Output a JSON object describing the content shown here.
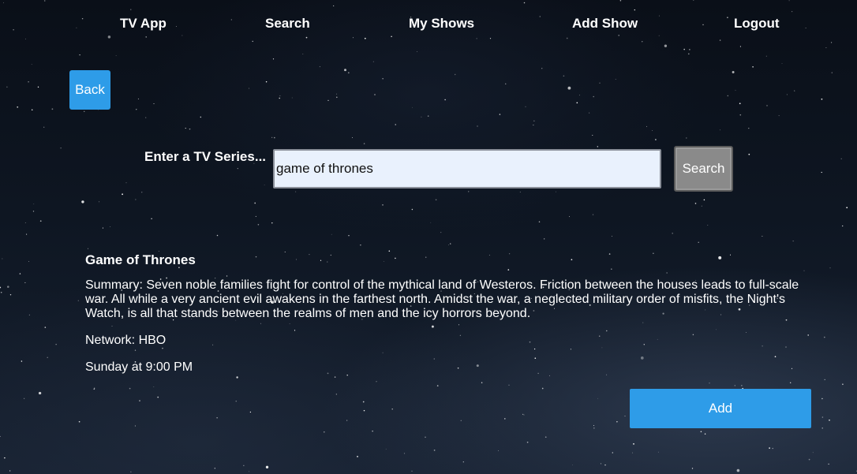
{
  "nav": {
    "brand": "TV App",
    "items": [
      {
        "label": "Search"
      },
      {
        "label": "My Shows"
      },
      {
        "label": "Add Show"
      },
      {
        "label": "Logout"
      }
    ]
  },
  "back_label": "Back",
  "search": {
    "label": "Enter a TV Series...",
    "value": "game of thrones",
    "button_label": "Search"
  },
  "result": {
    "title": "Game of Thrones",
    "summary": "Summary: Seven noble families fight for control of the mythical land of Westeros. Friction between the houses leads to full-scale war. All while a very ancient evil awakens in the farthest north. Amidst the war, a neglected military order of misfits, the Night's Watch, is all that stands between the realms of men and the icy horrors beyond.",
    "network": "Network: HBO",
    "schedule": "Sunday at 9:00 PM"
  },
  "add_label": "Add",
  "colors": {
    "accent": "#2e9ce8",
    "search_button": "#8a8a8a",
    "input_background": "#e9f1fd"
  }
}
